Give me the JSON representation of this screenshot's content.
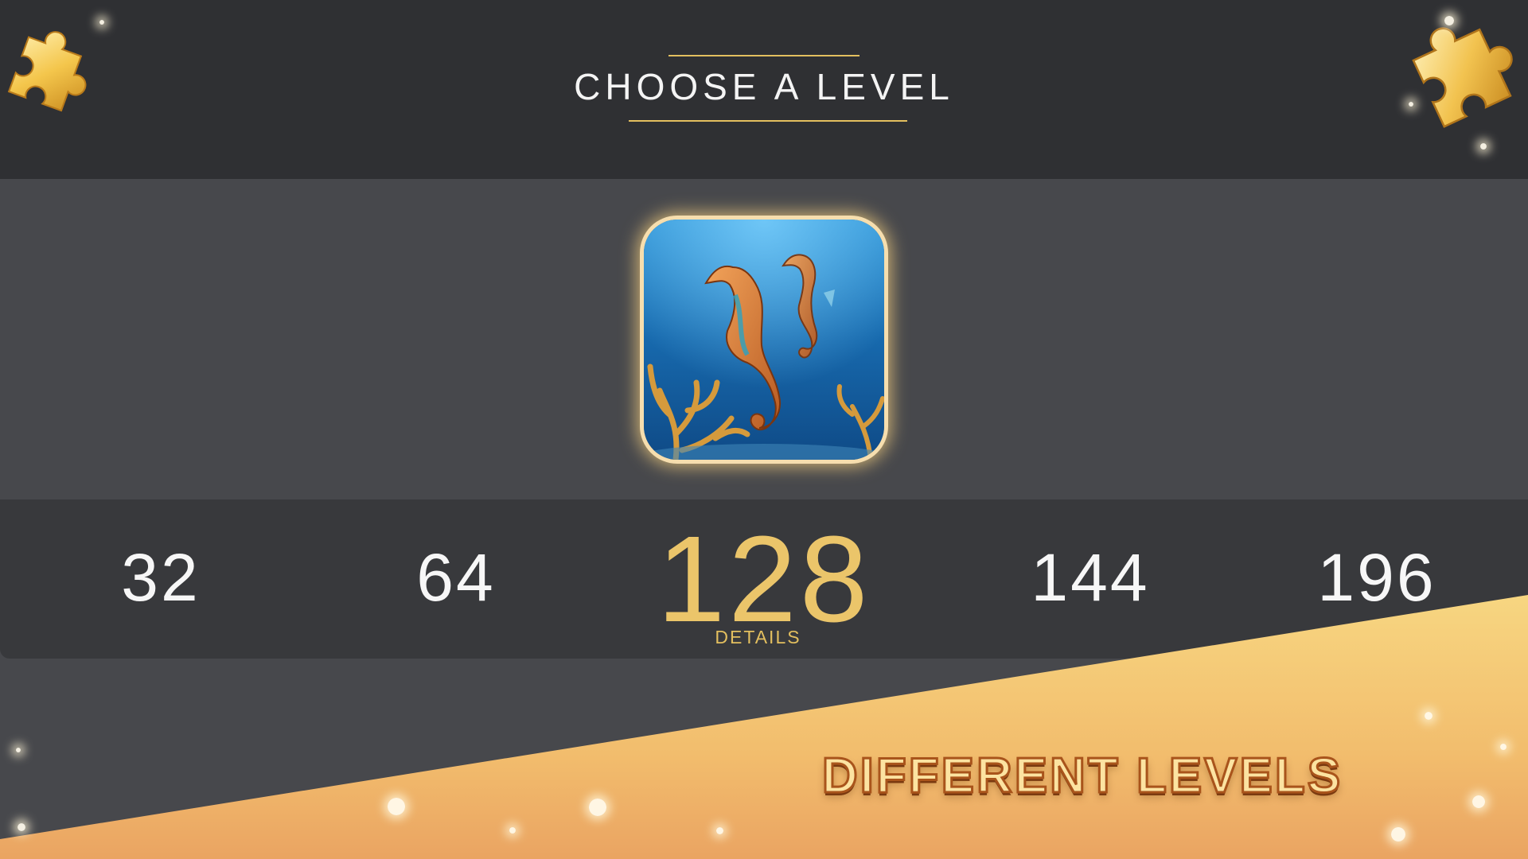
{
  "header": {
    "title": "CHOOSE A LEVEL"
  },
  "levels": {
    "options": [
      "32",
      "64",
      "128",
      "144",
      "196"
    ],
    "selected": "128",
    "selected_caption": "DETAILS"
  },
  "preview": {
    "subject": "seahorses"
  },
  "promo": {
    "text": "DIFFERENT LEVELS"
  },
  "colors": {
    "header_bg": "#2f3033",
    "body_bg": "#47484c",
    "bar_bg": "#38393c",
    "accent_gold": "#ebc56a",
    "banner_top": "#f7d681",
    "banner_bottom": "#eaa462"
  },
  "icons": [
    "puzzle-piece-icon"
  ]
}
